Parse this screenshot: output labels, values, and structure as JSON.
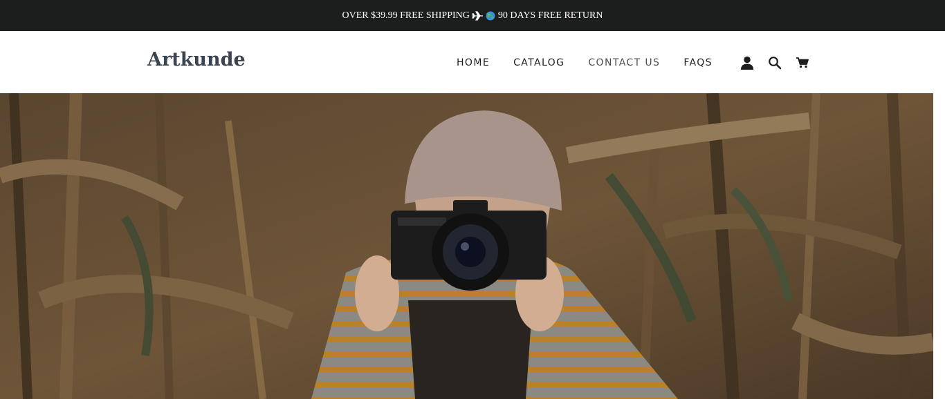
{
  "announcement": {
    "text_before": "OVER $39.99 FREE SHIPPING ",
    "text_after": " 90 DAYS FREE RETURN",
    "icons": [
      "airplane-icon",
      "globe-icon"
    ]
  },
  "header": {
    "logo": "Artkunde",
    "nav": [
      {
        "label": "HOME"
      },
      {
        "label": "CATALOG"
      },
      {
        "label": "CONTACT US"
      },
      {
        "label": "FAQS"
      }
    ],
    "icons": [
      "account-icon",
      "search-icon",
      "cart-icon"
    ]
  },
  "hero": {
    "image_description": "person in knit hat and striped sweater holding a camera in a cornfield"
  },
  "colors": {
    "announcement_bg": "#1c1d1d",
    "logo": "#3a4550",
    "nav_text": "#1c1d1d"
  }
}
